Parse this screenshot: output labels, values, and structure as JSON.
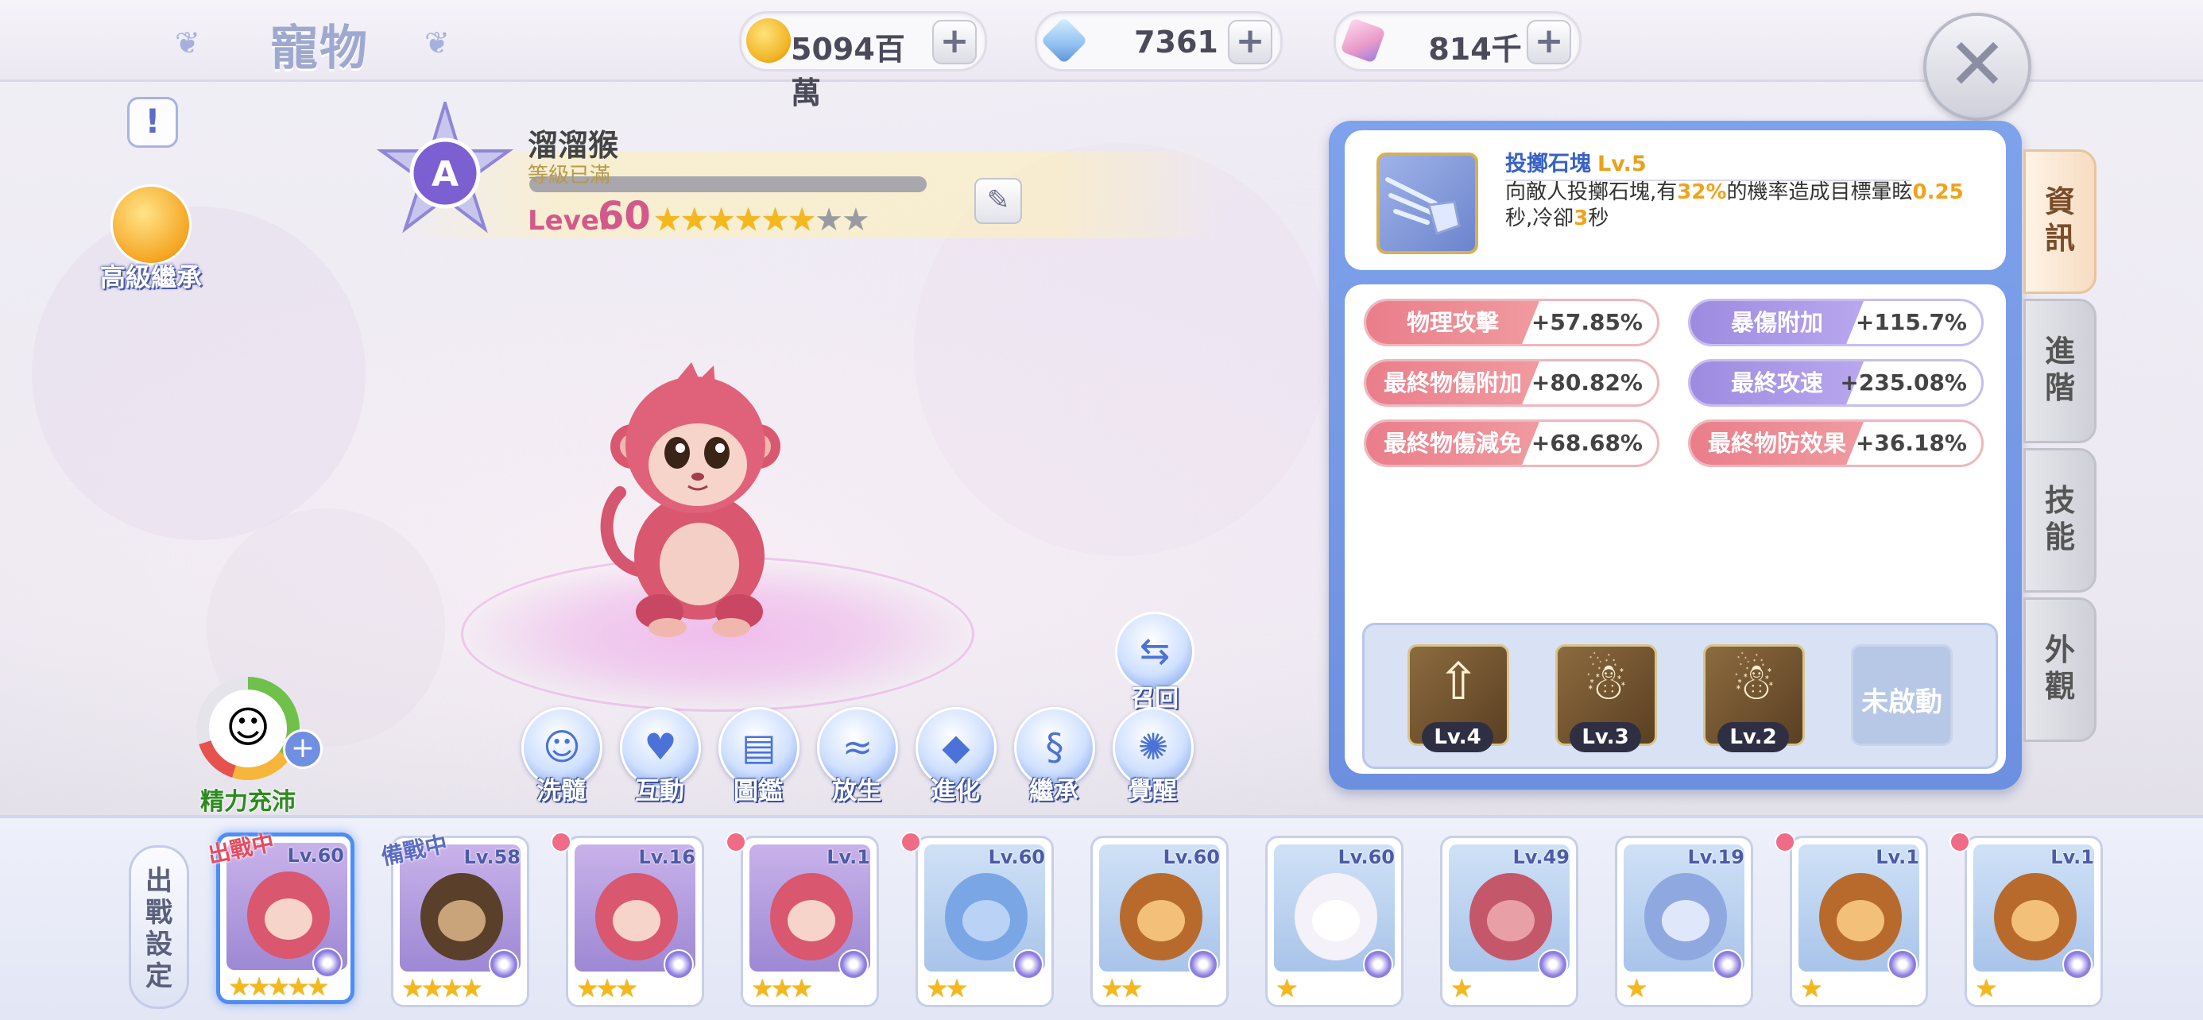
{
  "header": {
    "title": "寵物"
  },
  "resources": [
    {
      "name": "gold",
      "value": "5094百萬",
      "icon": "gold-coin-icon",
      "color": "#f2b526"
    },
    {
      "name": "diamond",
      "value": "7361",
      "icon": "diamond-icon",
      "color": "#8fc0f0"
    },
    {
      "name": "crystal",
      "value": "814千",
      "icon": "crystal-icon",
      "color": "#e89ac9"
    }
  ],
  "left": {
    "advanced_inherit": "高級繼承",
    "energy_label": "精力充沛"
  },
  "pet": {
    "grade": "A",
    "name": "溜溜猴",
    "level_status": "等級已滿",
    "level_label": "Level",
    "level": "60",
    "stars_filled": 6,
    "stars_total": 8
  },
  "actions": [
    {
      "label": "洗髓",
      "icon": "wash-icon",
      "glyph": "☺"
    },
    {
      "label": "互動",
      "icon": "heart-icon",
      "glyph": "♥"
    },
    {
      "label": "圖鑑",
      "icon": "book-icon",
      "glyph": "▤"
    },
    {
      "label": "放生",
      "icon": "fish-icon",
      "glyph": "≈"
    },
    {
      "label": "進化",
      "icon": "crystal-evolve-icon",
      "glyph": "◆"
    },
    {
      "label": "繼承",
      "icon": "dna-icon",
      "glyph": "§"
    },
    {
      "label": "覺醒",
      "icon": "awaken-icon",
      "glyph": "✺"
    }
  ],
  "recall": {
    "label": "召回",
    "icon": "recall-icon"
  },
  "skill": {
    "name": "投擲石塊",
    "level": "Lv.5",
    "desc_a": "向敵人投擲石塊,有",
    "desc_hl1": "32%",
    "desc_b": "的機率造成目標暈眩",
    "desc_hl2": "0.25",
    "desc_c": "秒,冷卻",
    "desc_hl3": "3",
    "desc_d": "秒"
  },
  "stats": [
    {
      "name": "物理攻擊",
      "value": "+57.85%",
      "style": "red"
    },
    {
      "name": "暴傷附加",
      "value": "+115.7%",
      "style": "pur"
    },
    {
      "name": "最終物傷附加",
      "value": "+80.82%",
      "style": "red"
    },
    {
      "name": "最終攻速",
      "value": "+235.08%",
      "style": "pur"
    },
    {
      "name": "最終物傷減免",
      "value": "+68.68%",
      "style": "red"
    },
    {
      "name": "最終物防效果",
      "value": "+36.18%",
      "style": "red"
    }
  ],
  "passives": [
    {
      "level": "Lv.4",
      "icon": "arrow-up-skill-icon",
      "glyph": "⇧"
    },
    {
      "level": "Lv.3",
      "icon": "figure-skill-icon",
      "glyph": "☃"
    },
    {
      "level": "Lv.2",
      "icon": "figure-skill-icon",
      "glyph": "☃"
    },
    {
      "locked_label": "未啟動",
      "icon": "locked-slot-icon"
    }
  ],
  "tabs": [
    {
      "label": "資訊",
      "active": true
    },
    {
      "label": "進階",
      "active": false
    },
    {
      "label": "技能",
      "active": false
    },
    {
      "label": "外觀",
      "active": false
    }
  ],
  "roster": {
    "deploy_label": "出戰設定",
    "pets": [
      {
        "level": "Lv.60",
        "stars": "★★★★★",
        "tag": "出戰中",
        "tag_color": "#e84a5f",
        "selected": true,
        "kind": "monkey"
      },
      {
        "level": "Lv.58",
        "stars": "★★★★",
        "tag": "備戰中",
        "tag_color": "#5a6cc7",
        "kind": "warrior"
      },
      {
        "level": "Lv.16",
        "stars": "★★★",
        "kind": "monkey"
      },
      {
        "level": "Lv.1",
        "stars": "★★★",
        "kind": "monkey"
      },
      {
        "level": "Lv.60",
        "stars": "★★",
        "kind": "slime"
      },
      {
        "level": "Lv.60",
        "stars": "★★",
        "kind": "lion"
      },
      {
        "level": "Lv.60",
        "stars": "★",
        "kind": "rabbit"
      },
      {
        "level": "Lv.49",
        "stars": "★",
        "kind": "snake"
      },
      {
        "level": "Lv.19",
        "stars": "★",
        "kind": "wolf"
      },
      {
        "level": "Lv.1",
        "stars": "★",
        "kind": "lion"
      },
      {
        "level": "Lv.1",
        "stars": "★",
        "kind": "lion"
      }
    ]
  }
}
